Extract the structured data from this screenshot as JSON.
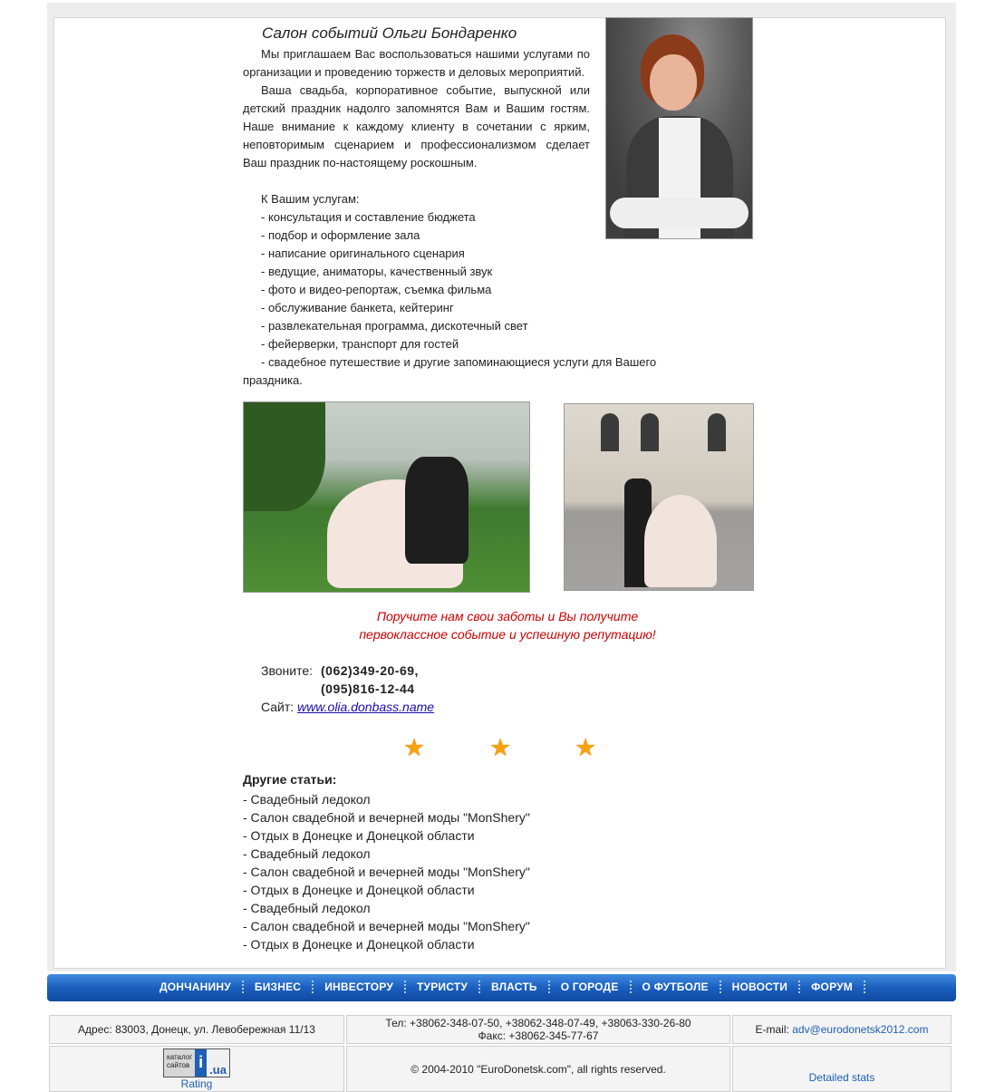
{
  "article": {
    "title": "Салон событий Ольги Бондаренко",
    "intro": [
      "Мы приглашаем Вас воспользоваться нашими услугами по организации и проведению торжеств и деловых мероприятий.",
      "Ваша свадьба, корпоративное событие, выпускной или детский праздник надолго запомнятся Вам и Вашим гостям. Наше внимание к каждому клиенту в сочетании с ярким, неповторимым сценарием и профессионализмом сделает Ваш праздник по-настоящему роскошным."
    ],
    "services_heading": "К Вашим услугам:",
    "services": [
      "- консультация и составление бюджета",
      "- подбор и оформление зала",
      "- написание оригинального сценария",
      "- ведущие, аниматоры, качественный звук",
      "- фото и видео-репортаж, съемка фильма",
      "- обслуживание банкета, кейтеринг",
      "- развлекательная программа, дискотечный свет",
      "- фейерверки, транспорт для гостей",
      "- свадебное путешествие и другие запоминающиеся услуги для Вашего"
    ],
    "services_cont": "праздника.",
    "slogan": [
      "Поручите нам свои заботы и Вы получите",
      "первоклассное событие и успешную репутацию!"
    ],
    "contact": {
      "call_label": "Звоните:",
      "phone1": "(062)349-20-69,",
      "phone2": "(095)816-12-44",
      "site_label": "Сайт:",
      "site": "www.olia.donbass.name"
    },
    "rating_stars": 3,
    "other_heading": "Другие статьи:",
    "other_articles": [
      "- Свадебный ледокол",
      "- Салон свадебной и вечерней моды \"MonShery\"",
      "- Отдых в Донецке и Донецкой области",
      "- Свадебный ледокол",
      "- Салон свадебной и вечерней моды \"MonShery\"",
      "- Отдых в Донецке и Донецкой области",
      "- Свадебный ледокол",
      "- Салон свадебной и вечерней моды \"MonShery\"",
      "- Отдых в Донецке и Донецкой области"
    ]
  },
  "nav": [
    "ДОНЧАНИНУ",
    "БИЗНЕС",
    "ИНВЕСТОРУ",
    "ТУРИСТУ",
    "ВЛАСТЬ",
    "О ГОРОДЕ",
    "О ФУТБОЛЕ",
    "НОВОСТИ",
    "ФОРУМ"
  ],
  "footer": {
    "address": "Адрес: 83003, Донецк, ул. Левобережная 11/13",
    "phones": "Тел: +38062-348-07-50, +38062-348-07-49, +38063-330-26-80",
    "fax": "Факс: +38062-345-77-67",
    "email_label": "E-mail:",
    "email": "adv@eurodonetsk2012.com",
    "badge_line1": "каталог",
    "badge_line2": "сайтов",
    "badge_i": "i",
    "badge_ua": ".ua",
    "rating": "Rating",
    "copyright": "© 2004-2010 \"EuroDonetsk.com\", all rights reserved.",
    "stats": "Detailed stats"
  }
}
